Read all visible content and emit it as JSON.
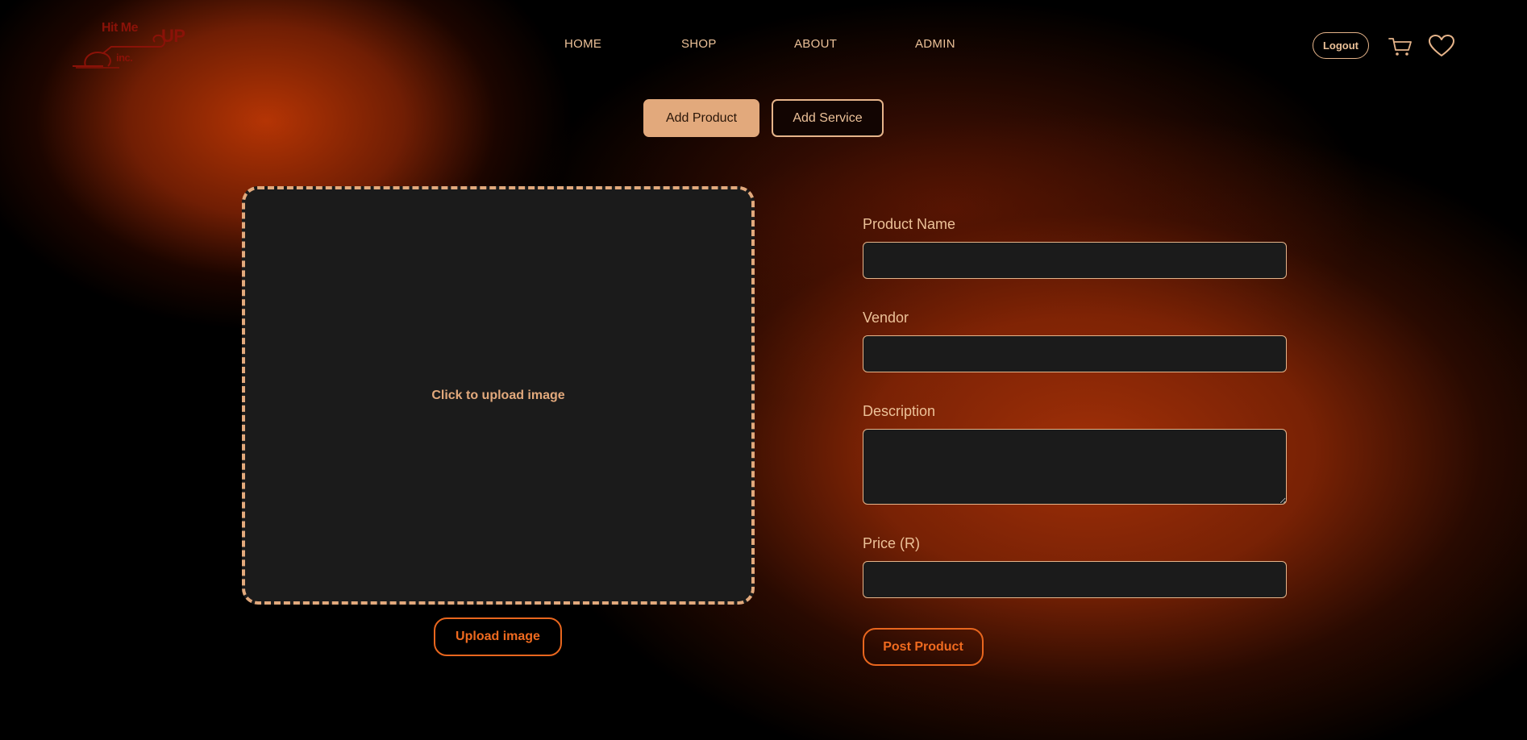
{
  "brand": {
    "logo_top": "Hit Me",
    "logo_right": "UP",
    "logo_bottom": "inc."
  },
  "nav": {
    "home": "HOME",
    "shop": "SHOP",
    "about": "ABOUT",
    "admin": "ADMIN"
  },
  "header_actions": {
    "logout_label": "Logout",
    "cart_icon": "shopping-cart-icon",
    "wishlist_icon": "heart-icon"
  },
  "tabs": {
    "add_product": "Add Product",
    "add_service": "Add Service",
    "active": "add_product"
  },
  "upload": {
    "hint": "Click to upload image",
    "button_label": "Upload image"
  },
  "form": {
    "product_name": {
      "label": "Product Name",
      "value": "",
      "placeholder": ""
    },
    "vendor": {
      "label": "Vendor",
      "value": "",
      "placeholder": ""
    },
    "description": {
      "label": "Description",
      "value": "",
      "placeholder": ""
    },
    "price": {
      "label": "Price (R)",
      "value": "",
      "placeholder": ""
    },
    "submit_label": "Post Product"
  },
  "colors": {
    "accent": "#e2a97c",
    "action": "#ef6a1f",
    "field_bg": "#1b1b1b",
    "page_bg": "#000000"
  }
}
